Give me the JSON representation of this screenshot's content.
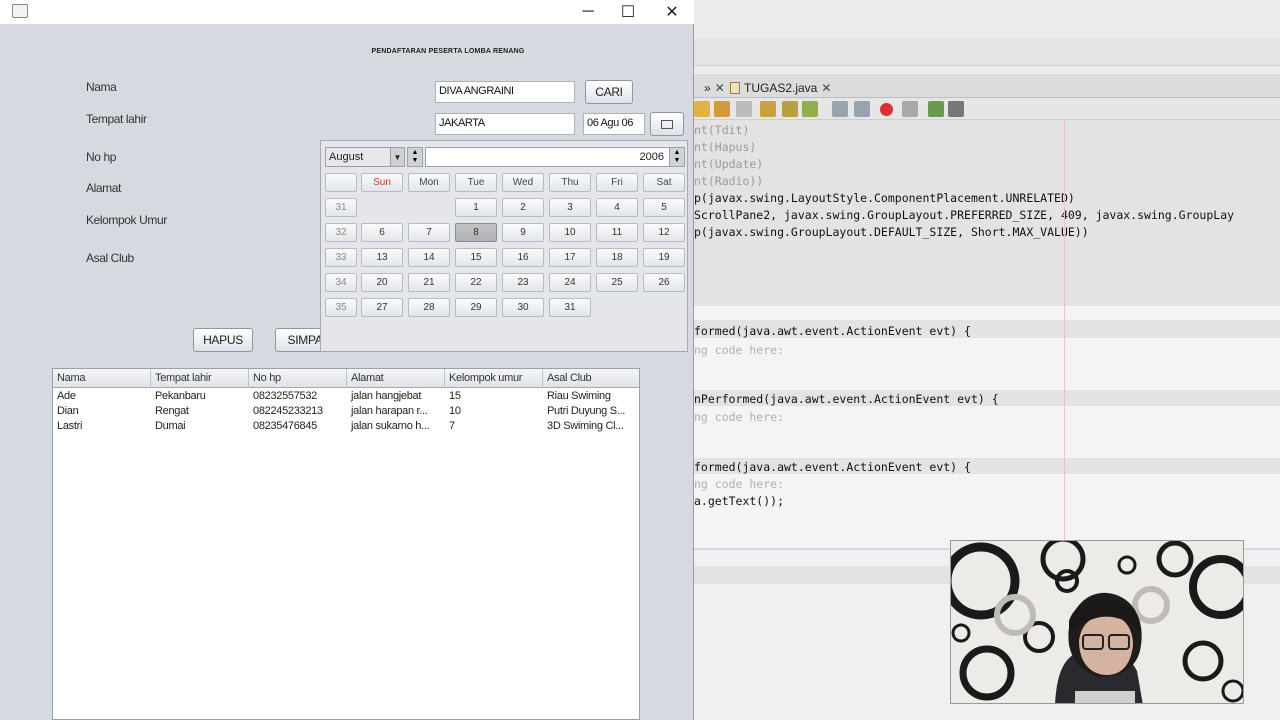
{
  "ide": {
    "tabs": [
      {
        "label": "TUGAS2.java"
      }
    ],
    "code_lines": [
      {
        "text": "nt(Tdit)"
      },
      {
        "text": "nt(Hapus)"
      },
      {
        "text": "nt(Update)"
      },
      {
        "text": "nt(Radio))"
      },
      {
        "text": "p(javax.swing.LayoutStyle.ComponentPlacement.UNRELATED)"
      },
      {
        "text": "ScrollPane2, javax.swing.GroupLayout.PREFERRED_SIZE, 409, javax.swing.GroupLay"
      },
      {
        "text": "p(javax.swing.GroupLayout.DEFAULT_SIZE, Short.MAX_VALUE))"
      },
      {
        "text": "formed(java.awt.event.ActionEvent evt) {"
      },
      {
        "text": "ng code here:"
      },
      {
        "text": "nPerformed(java.awt.event.ActionEvent evt) {"
      },
      {
        "text": "ng code here:"
      },
      {
        "text": "formed(java.awt.event.ActionEvent evt) {"
      },
      {
        "text": "ng code here:"
      },
      {
        "text": "a.getText());"
      }
    ]
  },
  "app": {
    "title": "PENDAFTARAN PESERTA LOMBA RENANG",
    "labels": {
      "nama": "Nama",
      "tempat_lahir": "Tempat lahir",
      "no_hp": "No hp",
      "alamat": "Alamat",
      "kelompok_umur": "Kelompok Umur",
      "asal_club": "Asal Club"
    },
    "fields": {
      "nama": "DIVA ANGRAINI",
      "tempat_lahir": "JAKARTA",
      "tanggal": "06 Agu 06"
    },
    "buttons": {
      "cari": "CARI",
      "hapus": "HAPUS",
      "simpan": "SIMPA"
    },
    "calendar": {
      "month": "August",
      "year": "2006",
      "day_headers": [
        "Sun",
        "Mon",
        "Tue",
        "Wed",
        "Thu",
        "Fri",
        "Sat"
      ],
      "weeks": [
        {
          "week": "31",
          "days": [
            "",
            "",
            "1",
            "2",
            "3",
            "4",
            "5"
          ]
        },
        {
          "week": "32",
          "days": [
            "6",
            "7",
            "8",
            "9",
            "10",
            "11",
            "12"
          ]
        },
        {
          "week": "33",
          "days": [
            "13",
            "14",
            "15",
            "16",
            "17",
            "18",
            "19"
          ]
        },
        {
          "week": "34",
          "days": [
            "20",
            "21",
            "22",
            "23",
            "24",
            "25",
            "26"
          ]
        },
        {
          "week": "35",
          "days": [
            "27",
            "28",
            "29",
            "30",
            "31",
            "",
            ""
          ]
        }
      ],
      "selected_day": "8"
    },
    "table": {
      "headers": [
        "Nama",
        "Tempat lahir",
        "No hp",
        "Alamat",
        "Kelompok umur",
        "Asal Club"
      ],
      "rows": [
        [
          "Ade",
          "Pekanbaru",
          "08232557532",
          "jalan hangjebat",
          "15",
          "Riau Swiming"
        ],
        [
          "Dian",
          "Rengat",
          "082245233213",
          "jalan harapan r...",
          "10",
          "Putri Duyung S..."
        ],
        [
          "Lastri",
          "Dumai",
          "08235476845",
          "jalan sukarno h...",
          "7",
          "3D Swiming Cl..."
        ]
      ]
    }
  },
  "colors": {
    "app_bg": "#d6d9df",
    "ide_bg": "#f4f4f4",
    "selected_day_bg": "#b4b7bc"
  }
}
